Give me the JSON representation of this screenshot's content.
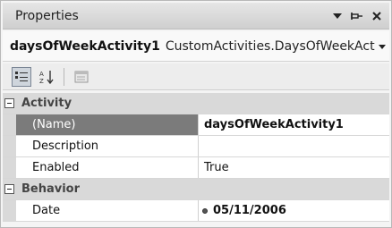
{
  "window": {
    "title": "Properties"
  },
  "selector": {
    "object_name": "daysOfWeekActivity1",
    "object_type": "CustomActivities.DaysOfWeekActivi"
  },
  "grid": {
    "categories": [
      {
        "label": "Activity",
        "properties": [
          {
            "name": "(Name)",
            "value": "daysOfWeekActivity1",
            "selected": true
          },
          {
            "name": "Description",
            "value": ""
          },
          {
            "name": "Enabled",
            "value": "True"
          }
        ]
      },
      {
        "label": "Behavior",
        "properties": [
          {
            "name": "Date",
            "value": "05/11/2006"
          }
        ]
      }
    ]
  }
}
